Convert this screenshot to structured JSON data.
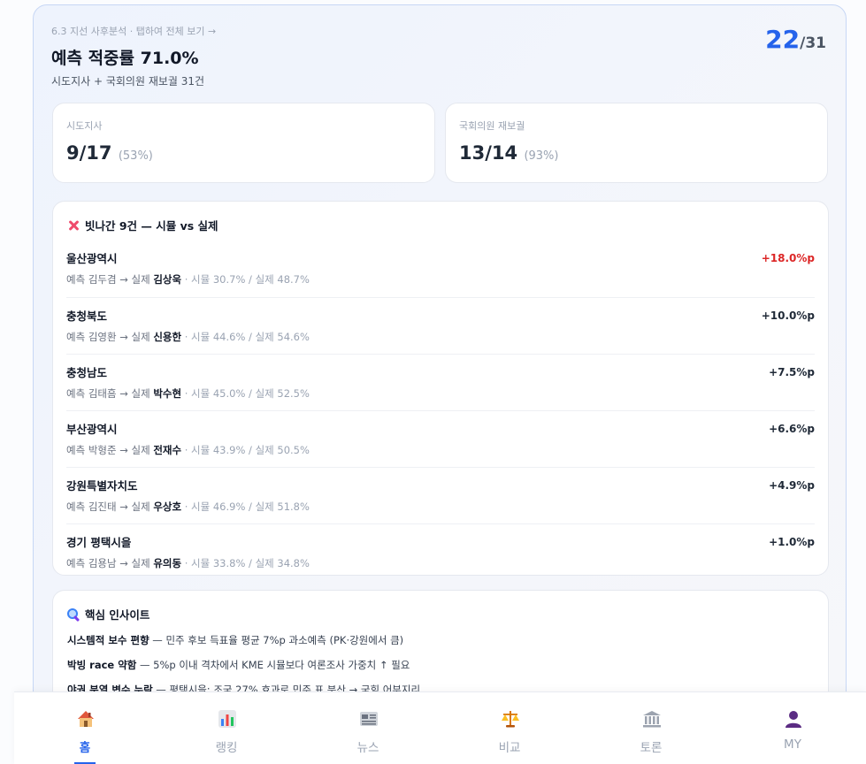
{
  "header": {
    "crumb": "6.3 지선 사후분석 · 탭하여 전체 보기 →",
    "title": "예측 적중률 71.0%",
    "subtitle": "시도지사 + 국회의원 재보궐 31건",
    "score_hit": "22",
    "score_total": "/31"
  },
  "stats": [
    {
      "label": "시도지사",
      "value": "9/17",
      "pct": "(53%)"
    },
    {
      "label": "국회의원 재보궐",
      "value": "13/14",
      "pct": "(93%)"
    }
  ],
  "misses": {
    "heading": "빗나간 9건 — 시뮬 vs 실제",
    "rows": [
      {
        "region": "울산광역시",
        "pred_prefix": "예측 김두겸 → 실제 ",
        "actual": "김상욱",
        "sim": " · 시뮬 30.7% / 실제 48.7%",
        "diff": "+18.0%p",
        "highlight": true
      },
      {
        "region": "충청북도",
        "pred_prefix": "예측 김영환 → 실제 ",
        "actual": "신용한",
        "sim": " · 시뮬 44.6% / 실제 54.6%",
        "diff": "+10.0%p",
        "highlight": false
      },
      {
        "region": "충청남도",
        "pred_prefix": "예측 김태흠 → 실제 ",
        "actual": "박수현",
        "sim": " · 시뮬 45.0% / 실제 52.5%",
        "diff": "+7.5%p",
        "highlight": false
      },
      {
        "region": "부산광역시",
        "pred_prefix": "예측 박형준 → 실제 ",
        "actual": "전재수",
        "sim": " · 시뮬 43.9% / 실제 50.5%",
        "diff": "+6.6%p",
        "highlight": false
      },
      {
        "region": "강원특별자치도",
        "pred_prefix": "예측 김진태 → 실제 ",
        "actual": "우상호",
        "sim": " · 시뮬 46.9% / 실제 51.8%",
        "diff": "+4.9%p",
        "highlight": false
      },
      {
        "region": "경기 평택시을",
        "pred_prefix": "예측 김용남 → 실제 ",
        "actual": "유의동",
        "sim": " · 시뮬 33.8% / 실제 34.8%",
        "diff": "+1.0%p",
        "highlight": false
      }
    ]
  },
  "insights": {
    "heading": "핵심 인사이트",
    "items": [
      {
        "bold": "시스템적 보수 편향",
        "text": " — 민주 후보 득표율 평균 7%p 과소예측 (PK·강원에서 큼)"
      },
      {
        "bold": "박빙 race 약함",
        "text": " — 5%p 이내 격차에서 KME 시뮬보다 여론조사 가중치 ↑ 필요"
      },
      {
        "bold": "야권 분열 변수 누락",
        "text": " — 평택시을: 조국 27% 효과로 민주 표 분산 → 국힘 어부지리"
      }
    ]
  },
  "nav": {
    "items": [
      {
        "label": "홈",
        "icon": "home-icon",
        "active": true
      },
      {
        "label": "랭킹",
        "icon": "ranking-chart-icon",
        "active": false
      },
      {
        "label": "뉴스",
        "icon": "newspaper-icon",
        "active": false
      },
      {
        "label": "비교",
        "icon": "scales-icon",
        "active": false
      },
      {
        "label": "토론",
        "icon": "forum-building-icon",
        "active": false
      },
      {
        "label": "MY",
        "icon": "user-icon",
        "active": false
      }
    ]
  }
}
